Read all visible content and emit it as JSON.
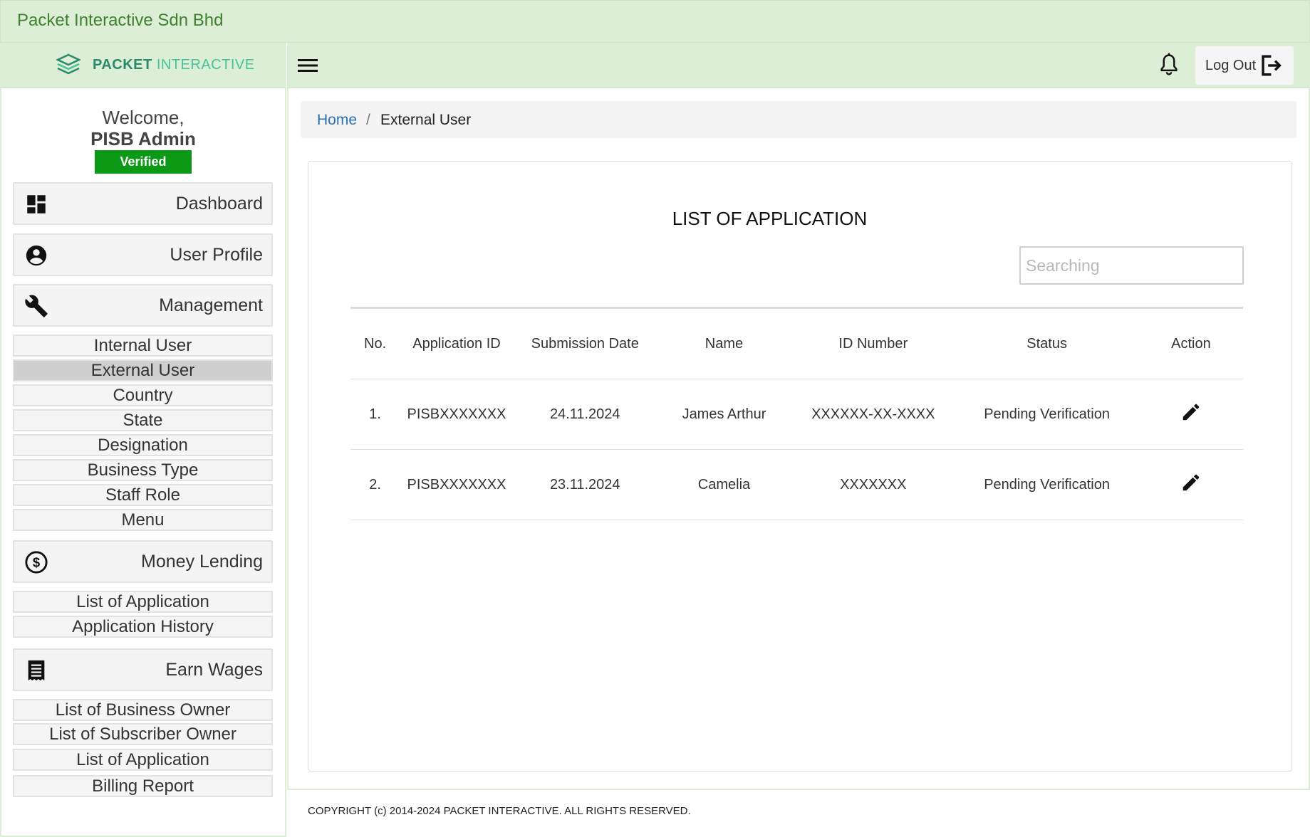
{
  "company": {
    "name": "Packet Interactive Sdn Bhd"
  },
  "logo": {
    "text_bold": "PACKET",
    "text_light": "INTERACTIVE"
  },
  "sidebar": {
    "welcome": "Welcome,",
    "user_name": "PISB Admin",
    "verified_badge": "Verified",
    "nav": {
      "dashboard": "Dashboard",
      "user_profile": "User Profile",
      "management": "Management",
      "money_lending": "Money Lending",
      "earn_wages": "Earn Wages"
    },
    "management_items": [
      "Internal User",
      "External User",
      "Country",
      "State",
      "Designation",
      "Business Type",
      "Staff Role",
      "Menu"
    ],
    "money_lending_items": [
      "List of Application",
      "Application History"
    ],
    "earn_wages_items": [
      "List of Business Owner",
      "List of Subscriber Owner",
      "List of Application",
      "Billing Report"
    ],
    "active_item": "External User"
  },
  "header": {
    "logout_label": "Log Out"
  },
  "breadcrumb": {
    "home": "Home",
    "separator": "/",
    "current": "External User"
  },
  "main": {
    "title": "LIST OF APPLICATION",
    "search_placeholder": "Searching",
    "columns": [
      "No.",
      "Application ID",
      "Submission Date",
      "Name",
      "ID Number",
      "Status",
      "Action"
    ],
    "rows": [
      {
        "no": "1.",
        "application_id": "PISBXXXXXXX",
        "submission_date": "24.11.2024",
        "name": "James Arthur",
        "id_number": "XXXXXX-XX-XXXX",
        "status": "Pending Verification"
      },
      {
        "no": "2.",
        "application_id": "PISBXXXXXXX",
        "submission_date": "23.11.2024",
        "name": "Camelia",
        "id_number": "XXXXXXX",
        "status": "Pending Verification"
      }
    ]
  },
  "footer": {
    "copyright": "COPYRIGHT (c) 2014-2024 PACKET INTERACTIVE. ALL RIGHTS RESERVED."
  },
  "icons": {
    "logo": "layers-icon",
    "dashboard": "dashboard-icon",
    "user_profile": "account-circle-icon",
    "management": "wrench-icon",
    "money_lending": "dollar-circle-icon",
    "earn_wages": "receipt-icon",
    "menu": "hamburger-icon",
    "notifications": "bell-icon",
    "logout": "logout-icon",
    "edit": "pencil-icon"
  },
  "colors": {
    "header_bg": "#dcefd6",
    "company_text": "#3f7f2f",
    "verified": "#0c9a16",
    "link": "#2a6fb0",
    "active_item": "#cfcfcf"
  }
}
